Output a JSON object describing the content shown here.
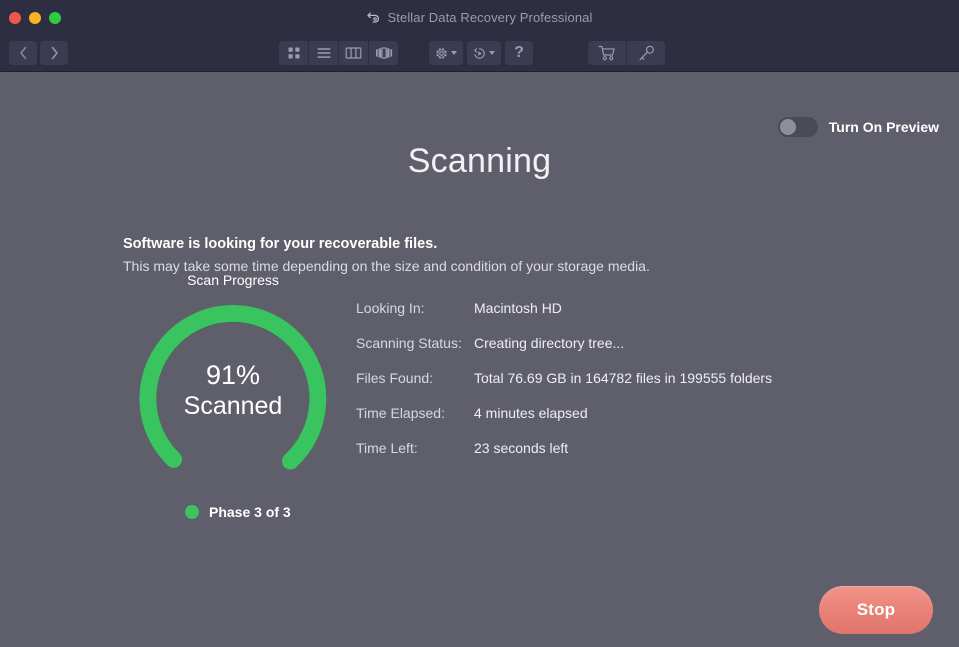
{
  "window": {
    "app_title": "Stellar Data Recovery Professional",
    "title_icon": "undo-arrow-icon",
    "controls": {
      "close": "close-window",
      "minimize": "minimize-window",
      "zoom": "zoom-window"
    }
  },
  "toolbar": {
    "nav": [
      {
        "name": "back-button",
        "icon": "chevron-left-icon"
      },
      {
        "name": "forward-button",
        "icon": "chevron-right-icon"
      }
    ],
    "view_modes": [
      {
        "name": "icon-view-button",
        "icon": "grid-view-icon"
      },
      {
        "name": "list-view-button",
        "icon": "list-view-icon"
      },
      {
        "name": "column-view-button",
        "icon": "column-view-icon"
      },
      {
        "name": "coverflow-view-button",
        "icon": "gallery-view-icon"
      }
    ],
    "actions": [
      {
        "name": "settings-button",
        "icon": "gear-icon",
        "has_caret": true
      },
      {
        "name": "history-button",
        "icon": "clock-rewind-icon",
        "has_caret": true
      },
      {
        "name": "help-button",
        "icon": "question-mark-icon",
        "glyph": "?"
      }
    ],
    "purchase": [
      {
        "name": "buy-now-button",
        "icon": "shopping-cart-icon"
      },
      {
        "name": "activate-button",
        "icon": "key-icon"
      }
    ]
  },
  "header": {
    "page_title": "Scanning",
    "preview_toggle": {
      "label": "Turn On Preview",
      "state": "off"
    }
  },
  "intro": {
    "headline": "Software is looking for your recoverable files.",
    "subtext": "This may take some time depending on the size and condition of your storage media."
  },
  "gauge": {
    "caption": "Scan Progress",
    "percent_label": "91%",
    "state_label": "Scanned",
    "percent_value": 91,
    "track_color": "#282838",
    "progress_color": "#3ac45f"
  },
  "phase": {
    "label": "Phase 3 of 3",
    "dot_color": "#3ac45f",
    "current": 3,
    "total": 3
  },
  "details": [
    {
      "label": "Looking In:",
      "value": "Macintosh HD"
    },
    {
      "label": "Scanning Status:",
      "value": "Creating directory tree..."
    },
    {
      "label": "Files Found:",
      "value": "Total 76.69 GB in 164782 files in 199555 folders"
    },
    {
      "label": "Time Elapsed:",
      "value": "4 minutes elapsed"
    },
    {
      "label": "Time Left:",
      "value": "23 seconds left"
    }
  ],
  "footer": {
    "stop_label": "Stop",
    "stop_color": "#ea8378"
  }
}
